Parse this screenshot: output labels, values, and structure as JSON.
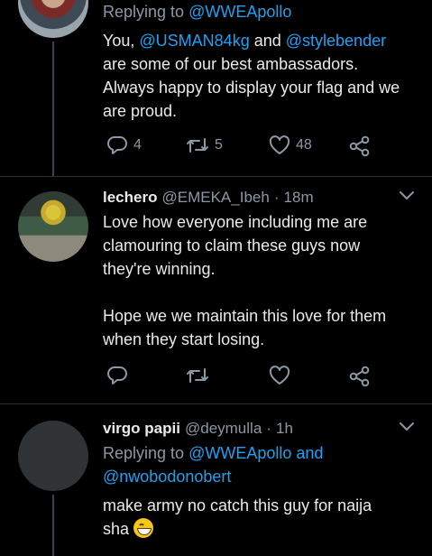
{
  "tweets": [
    {
      "replying_prefix": "Replying to",
      "replying_to": "@WWEApollo",
      "body_lines": [
        [
          "You, ",
          "@USMAN84kg",
          " and ",
          "@stylebender"
        ],
        [
          "are some of our best ambassadors."
        ],
        [
          "Always happy to display your flag and we"
        ],
        [
          "are proud."
        ]
      ],
      "actions": {
        "replies": "4",
        "retweets": "5",
        "likes": "48"
      }
    },
    {
      "display_name": "lechero",
      "handle": "@EMEKA_Ibeh",
      "dot": "·",
      "time": "18m",
      "body_lines": [
        "Love how everyone including me are",
        "clamouring to claim these guys now",
        "they're winning.",
        "",
        "Hope we we maintain this love for them",
        "when they start losing."
      ]
    },
    {
      "display_name": "virgo papii",
      "handle": "@deymulla",
      "dot": "·",
      "time": "1h",
      "replying_prefix": "Replying to",
      "replying_to_1": "@WWEApollo",
      "replying_and": "and",
      "replying_to_2": "@nwobodonobert",
      "body_line_1": "make army no catch this guy for naija",
      "body_line_2": "sha",
      "emoji_name": "grinning-face-emoji"
    }
  ],
  "colors": {
    "background": "#000000",
    "text": "#e8eaec",
    "muted": "#8b98a5",
    "link": "#1da1f2",
    "divider": "#2b2f33"
  }
}
